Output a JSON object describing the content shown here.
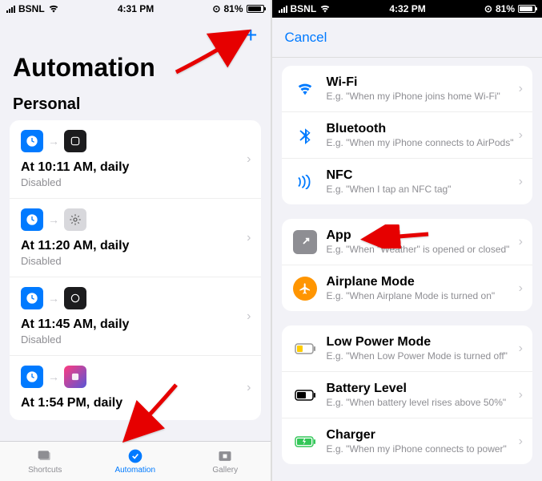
{
  "left": {
    "status": {
      "carrier": "BSNL",
      "time": "4:31 PM",
      "battery": "81%"
    },
    "title": "Automation",
    "section": "Personal",
    "items": [
      {
        "time": "At 10:11 AM, daily",
        "status": "Disabled"
      },
      {
        "time": "At 11:20 AM, daily",
        "status": "Disabled"
      },
      {
        "time": "At 11:45 AM, daily",
        "status": "Disabled"
      },
      {
        "time": "At 1:54 PM, daily",
        "status": ""
      }
    ],
    "tabs": {
      "shortcuts": "Shortcuts",
      "automation": "Automation",
      "gallery": "Gallery"
    }
  },
  "right": {
    "status": {
      "carrier": "BSNL",
      "time": "4:32 PM",
      "battery": "81%"
    },
    "cancel": "Cancel",
    "groups": [
      [
        {
          "title": "Wi-Fi",
          "sub": "E.g. \"When my iPhone joins home Wi-Fi\""
        },
        {
          "title": "Bluetooth",
          "sub": "E.g. \"When my iPhone connects to AirPods\""
        },
        {
          "title": "NFC",
          "sub": "E.g. \"When I tap an NFC tag\""
        }
      ],
      [
        {
          "title": "App",
          "sub": "E.g. \"When \"Weather\" is opened or closed\""
        },
        {
          "title": "Airplane Mode",
          "sub": "E.g. \"When Airplane Mode is turned on\""
        }
      ],
      [
        {
          "title": "Low Power Mode",
          "sub": "E.g. \"When Low Power Mode is turned off\""
        },
        {
          "title": "Battery Level",
          "sub": "E.g. \"When battery level rises above 50%\""
        },
        {
          "title": "Charger",
          "sub": "E.g. \"When my iPhone connects to power\""
        }
      ]
    ]
  }
}
